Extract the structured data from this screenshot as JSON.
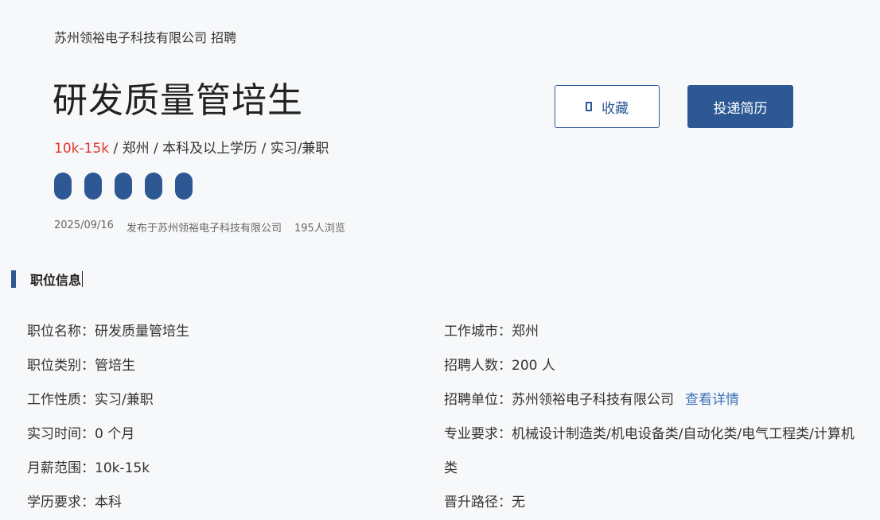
{
  "header": {
    "company_recruit": "苏州领裕电子科技有限公司 招聘",
    "job_title": "研发质量管培生",
    "salary": "10k-15k",
    "meta_rest": " / 郑州 / 本科及以上学历 / 实习/兼职",
    "tag_count": 5,
    "publish_date": "2025/09/16",
    "publisher": "发布于苏州领裕电子科技有限公司",
    "views": "195人浏览",
    "accent_color": "#2d5894",
    "salary_color": "#e0362c"
  },
  "actions": {
    "favorite_label": "收藏",
    "apply_label": "投递简历"
  },
  "section": {
    "title": "职位信息"
  },
  "info_left": [
    {
      "label": "职位名称：",
      "value": "研发质量管培生"
    },
    {
      "label": "职位类别：",
      "value": "管培生"
    },
    {
      "label": "工作性质：",
      "value": "实习/兼职"
    },
    {
      "label": "实习时间：",
      "value": "0 个月"
    },
    {
      "label": "月薪范围：",
      "value": "10k-15k"
    },
    {
      "label": "学历要求：",
      "value": "本科"
    }
  ],
  "info_right": [
    {
      "label": "工作城市：",
      "value": "郑州"
    },
    {
      "label": "招聘人数：",
      "value": "200 人"
    },
    {
      "label": "招聘单位：",
      "value": "苏州领裕电子科技有限公司",
      "link": "查看详情"
    },
    {
      "label": "专业要求：",
      "value": "机械设计制造类/机电设备类/自动化类/电气工程类/计算机类"
    },
    {
      "label": "晋升路径：",
      "value": "无"
    }
  ]
}
